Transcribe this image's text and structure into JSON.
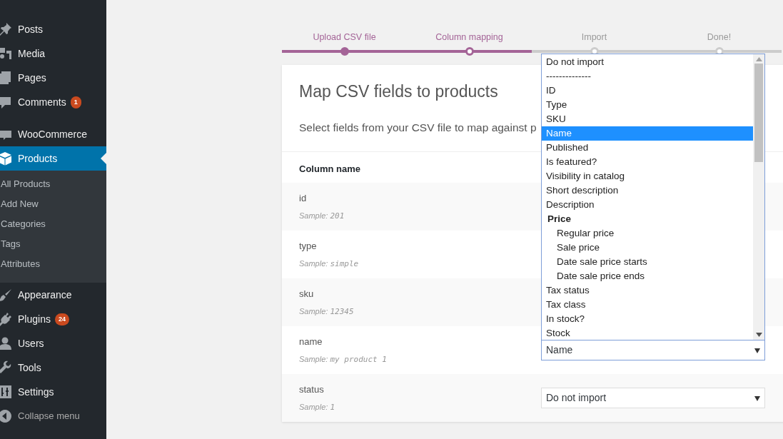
{
  "sidebar": {
    "items": [
      {
        "label": "Posts",
        "selected": false
      },
      {
        "label": "Media",
        "selected": false
      },
      {
        "label": "Pages",
        "selected": false
      },
      {
        "label": "Comments",
        "badge": "1",
        "selected": false
      },
      {
        "label": "WooCommerce",
        "selected": false
      },
      {
        "label": "Products",
        "selected": true,
        "children": [
          {
            "label": "All Products"
          },
          {
            "label": "Add New"
          },
          {
            "label": "Categories"
          },
          {
            "label": "Tags"
          },
          {
            "label": "Attributes"
          }
        ]
      },
      {
        "label": "Appearance",
        "selected": false
      },
      {
        "label": "Plugins",
        "badge": "24",
        "selected": false
      },
      {
        "label": "Users",
        "selected": false
      },
      {
        "label": "Tools",
        "selected": false
      },
      {
        "label": "Settings",
        "selected": false
      }
    ],
    "collapse": "Collapse menu"
  },
  "steps": [
    {
      "label": "Upload CSV file",
      "reached": true,
      "completed": true
    },
    {
      "label": "Column mapping",
      "reached": true,
      "completed": false
    },
    {
      "label": "Import",
      "reached": false,
      "completed": false
    },
    {
      "label": "Done!",
      "reached": false,
      "completed": false
    }
  ],
  "card": {
    "title": "Map CSV fields to products",
    "subtitle": "Select fields from your CSV file to map against p",
    "table": {
      "column_1": "Column name",
      "rows": [
        {
          "name": "id",
          "sample_label": "Sample:",
          "sample": "201"
        },
        {
          "name": "type",
          "sample_label": "Sample:",
          "sample": "simple"
        },
        {
          "name": "sku",
          "sample_label": "Sample:",
          "sample": "12345"
        },
        {
          "name": "name",
          "sample_label": "Sample:",
          "sample": "my product 1",
          "mapping": "Name",
          "expanded": true
        },
        {
          "name": "status",
          "sample_label": "Sample:",
          "sample": "1",
          "mapping": "Do not import",
          "expanded": false
        }
      ]
    }
  },
  "dropdown": {
    "options": [
      {
        "label": "Do not import",
        "selected": false
      },
      {
        "label": "--------------",
        "selected": false
      },
      {
        "label": "ID",
        "selected": false
      },
      {
        "label": "Type",
        "selected": false
      },
      {
        "label": "SKU",
        "selected": false
      },
      {
        "label": "Name",
        "selected": true
      },
      {
        "label": "Published",
        "selected": false
      },
      {
        "label": "Is featured?",
        "selected": false
      },
      {
        "label": "Visibility in catalog",
        "selected": false
      },
      {
        "label": "Short description",
        "selected": false
      },
      {
        "label": "Description",
        "selected": false
      },
      {
        "label": "Price",
        "kind": "group",
        "children": [
          {
            "label": "Regular price",
            "selected": false
          },
          {
            "label": "Sale price",
            "selected": false
          },
          {
            "label": "Date sale price starts",
            "selected": false
          },
          {
            "label": "Date sale price ends",
            "selected": false
          }
        ]
      },
      {
        "label": "Tax status",
        "selected": false
      },
      {
        "label": "Tax class",
        "selected": false
      },
      {
        "label": "In stock?",
        "selected": false
      },
      {
        "label": "Stock",
        "selected": false
      }
    ]
  }
}
